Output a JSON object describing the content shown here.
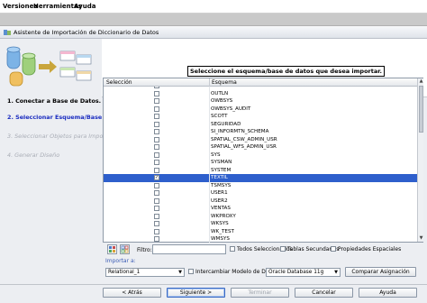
{
  "menubar": {
    "items": [
      {
        "label": "Versiones",
        "accel": "V"
      },
      {
        "label": "Herramientas",
        "accel": "H"
      },
      {
        "label": "Ayuda",
        "accel": "A"
      }
    ]
  },
  "dialog": {
    "title": "Asistente de Importación de Diccionario de Datos",
    "header_prompt": "Seleccione el esquema/base de datos que desea importar."
  },
  "steps": [
    {
      "label": "1. Conectar a Base de Datos.",
      "state": "done"
    },
    {
      "label": "2. Seleccionar Esquema/Base de D...",
      "state": "active"
    },
    {
      "label": "3. Seleccionar Objetos para Importar.",
      "state": "future"
    },
    {
      "label": "4. Generar Diseño",
      "state": "future"
    }
  ],
  "table": {
    "headers": {
      "selection": "Selección",
      "schema": "Esquema"
    },
    "rows": [
      {
        "name": "ORDSYS",
        "checked": false
      },
      {
        "name": "OUTLN",
        "checked": false
      },
      {
        "name": "OWBSYS",
        "checked": false
      },
      {
        "name": "OWBSYS_AUDIT",
        "checked": false
      },
      {
        "name": "SCOTT",
        "checked": false
      },
      {
        "name": "SEGURIDAD",
        "checked": false
      },
      {
        "name": "SI_INFORMTN_SCHEMA",
        "checked": false
      },
      {
        "name": "SPATIAL_CSW_ADMIN_USR",
        "checked": false
      },
      {
        "name": "SPATIAL_WFS_ADMIN_USR",
        "checked": false
      },
      {
        "name": "SYS",
        "checked": false
      },
      {
        "name": "SYSMAN",
        "checked": false
      },
      {
        "name": "SYSTEM",
        "checked": false
      },
      {
        "name": "TEXTIL",
        "checked": true,
        "selected": true
      },
      {
        "name": "TSMSYS",
        "checked": false
      },
      {
        "name": "USER1",
        "checked": false
      },
      {
        "name": "USER2",
        "checked": false
      },
      {
        "name": "VENTAS",
        "checked": false
      },
      {
        "name": "WKPROXY",
        "checked": false
      },
      {
        "name": "WKSYS",
        "checked": false
      },
      {
        "name": "WK_TEST",
        "checked": false
      },
      {
        "name": "WMSYS",
        "checked": false
      },
      {
        "name": "XDB",
        "checked": false
      },
      {
        "name": "XS$NULL",
        "checked": false
      }
    ]
  },
  "filter": {
    "label": "Filtro:",
    "value": "",
    "options": [
      {
        "label": "Todos Seleccionados",
        "checked": false
      },
      {
        "label": "Tablas Secundarias",
        "checked": false
      },
      {
        "label": "Propiedades Espaciales",
        "checked": false
      }
    ]
  },
  "import": {
    "label": "Importar a:",
    "target": "Relational_1",
    "swap_label": "Intercambiar Modelo de Destino",
    "swap_checked": false,
    "database": "Oracle Database 11g",
    "compare_button": "Comparar Asignación"
  },
  "footer": {
    "back": "< Atrás",
    "next": "Siguiente >",
    "finish": "Terminar",
    "cancel": "Cancelar",
    "help": "Ayuda"
  },
  "colors": {
    "active_step": "#1a2cc0",
    "selection": "#2e5fcc",
    "link": "#3b5cb5"
  }
}
